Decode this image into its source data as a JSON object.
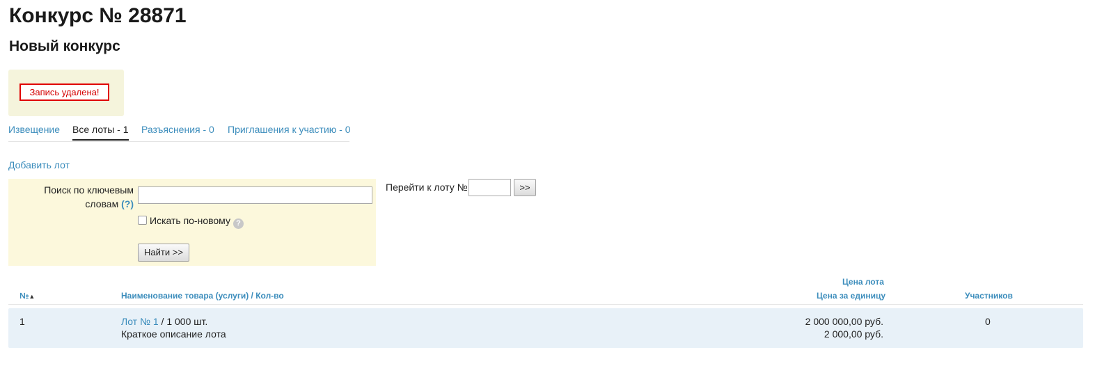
{
  "page": {
    "title": "Конкурс № 28871",
    "subtitle": "Новый конкурс"
  },
  "notice": {
    "message": "Запись удалена!"
  },
  "tabs": [
    {
      "label": "Извещение",
      "active": false
    },
    {
      "label": "Все лоты - 1",
      "active": true
    },
    {
      "label": "Разъяснения - 0",
      "active": false
    },
    {
      "label": "Приглашения к участию - 0",
      "active": false
    }
  ],
  "actions": {
    "add_lot": "Добавить лот"
  },
  "search": {
    "label_line1": "Поиск по ключевым",
    "label_line2": "словам",
    "help_open": "(",
    "help_q": "?",
    "help_close": ")",
    "value": "",
    "new_search_label": "Искать по-новому",
    "new_search_checked": false,
    "find_button": "Найти >>"
  },
  "goto": {
    "label": "Перейти к лоту №",
    "value": "",
    "button": ">>"
  },
  "table": {
    "headers": {
      "number": "№",
      "name": "Наименование товара (услуги) / Кол-во",
      "lot_price": "Цена лота",
      "unit_price": "Цена за единицу",
      "participants": "Участников"
    },
    "rows": [
      {
        "number": "1",
        "lot_link": "Лот № 1",
        "separator": " / ",
        "quantity": "1 000 шт.",
        "description": "Краткое описание лота",
        "lot_price": "2 000 000,00 руб.",
        "unit_price": "2 000,00 руб.",
        "participants": "0"
      }
    ]
  },
  "colors": {
    "link": "#3c8dbc",
    "notice_bg": "#f5f4dc",
    "notice_border": "#e00000",
    "search_bg": "#fcf8dc",
    "row_bg": "#e8f1f8"
  }
}
